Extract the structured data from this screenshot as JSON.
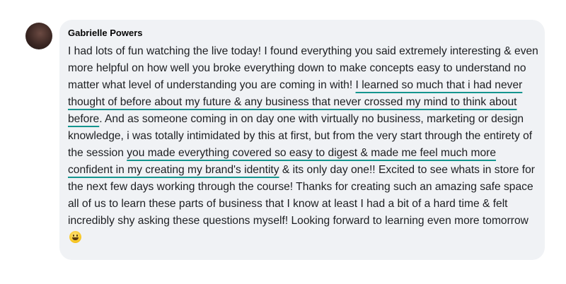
{
  "comment": {
    "author": "Gabrielle Powers",
    "segments": [
      {
        "text": "I had lots of fun watching the live today! I found everything you said extremely interesting & even more helpful on how well you broke everything down to make concepts easy to understand no matter what level of understanding you are coming in with! ",
        "highlight": false
      },
      {
        "text": "I learned so much that i had never thought of before about my future & any business that never crossed my mind to think about before",
        "highlight": true
      },
      {
        "text": ". And as someone coming in on day one with virtually no business, marketing or design knowledge, i was totally intimidated by this at first, but from the very start through the entirety of the session ",
        "highlight": false
      },
      {
        "text": "you made everything covered so easy to digest & made me feel much more confident in my creating my brand's identity",
        "highlight": true
      },
      {
        "text": " & its only day one!! Excited to see whats in store for the next few days working through the course! Thanks for creating such an amazing safe space all of us to learn these parts of business that I know at least I had a bit of a hard time & felt incredibly shy asking these questions myself! Looking forward to learning even more tomorrow ",
        "highlight": false
      }
    ],
    "emoji": "grinning-face-emoji",
    "highlight_color": "#14958f",
    "bubble_color": "#f0f2f5"
  }
}
